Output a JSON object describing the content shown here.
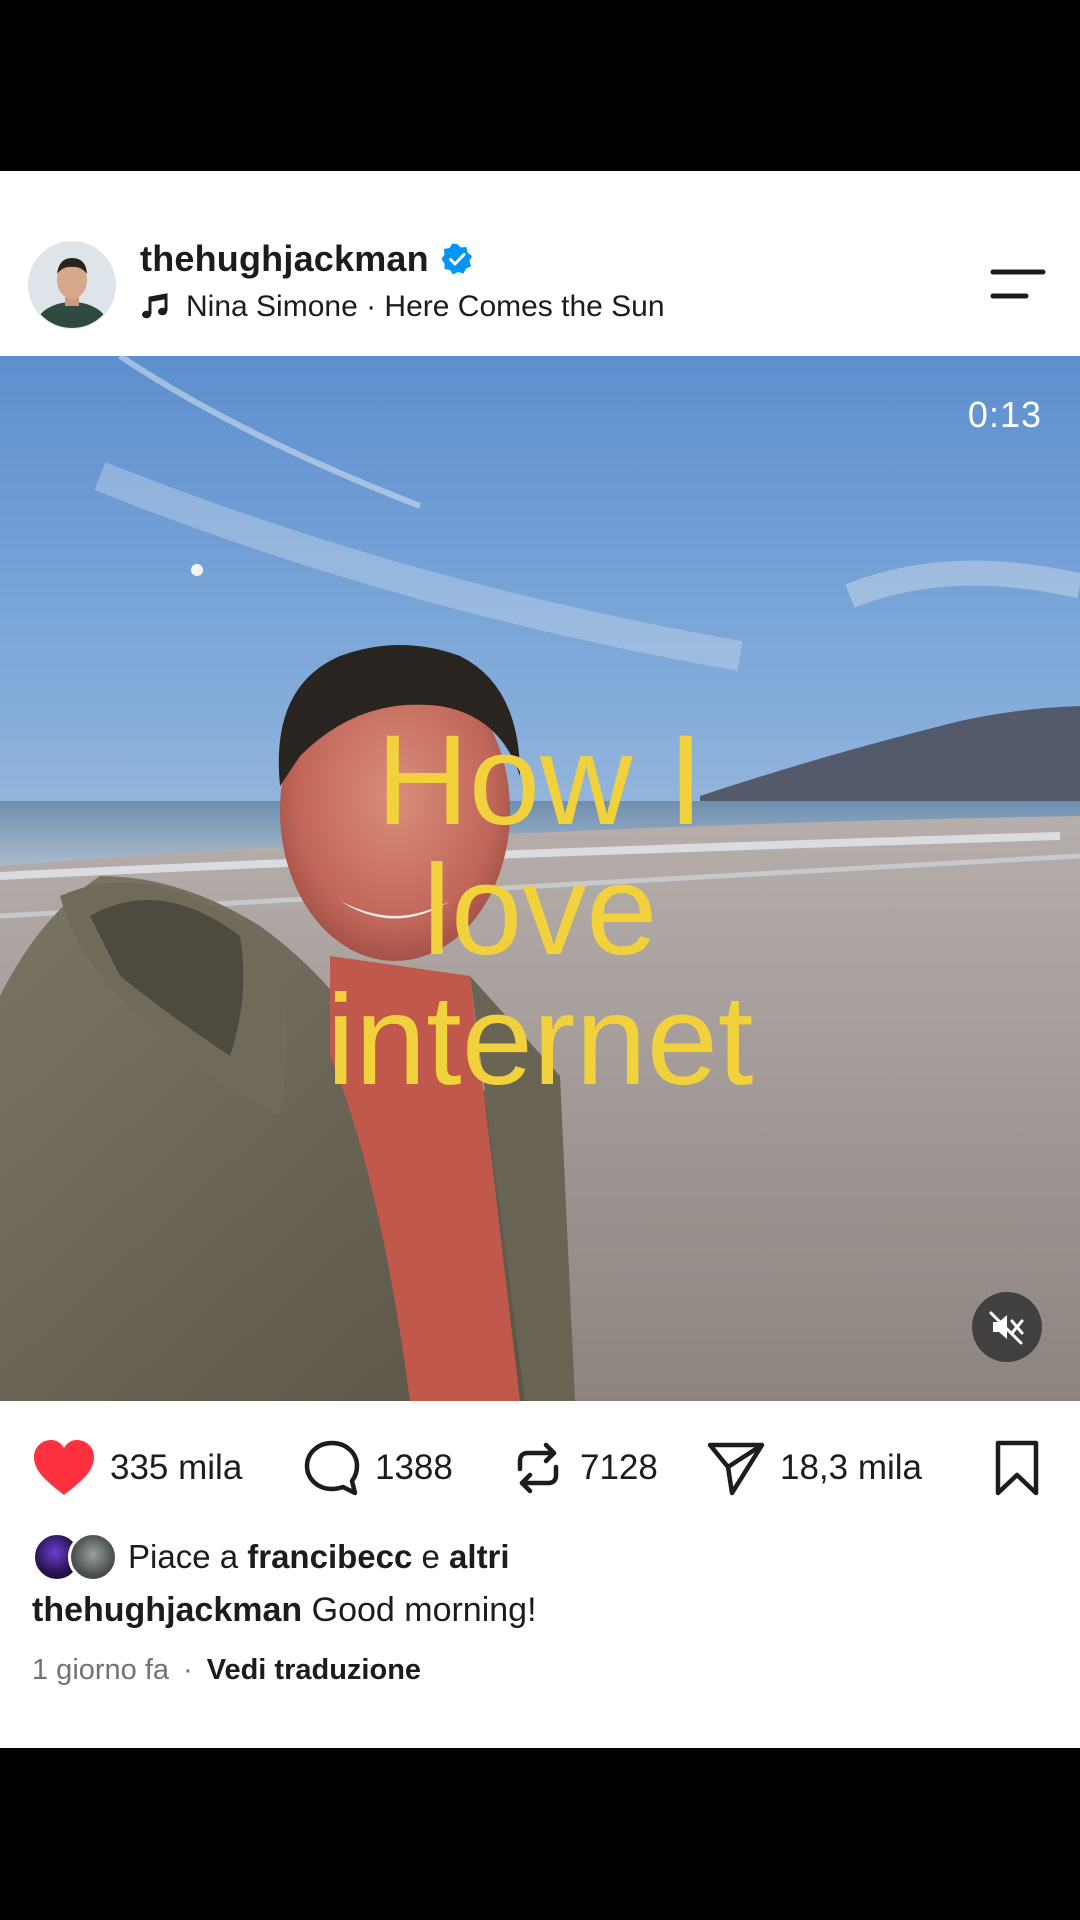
{
  "post": {
    "username": "thehughjackman",
    "verified": true,
    "music": "Nina Simone · Here Comes the Sun"
  },
  "media": {
    "timer": "0:13",
    "overlay_lines": [
      "How I",
      "love",
      "internet"
    ],
    "overlay_color": "#f2d23c",
    "muted": true
  },
  "actions": {
    "likes": "335 mila",
    "comments": "1388",
    "reposts": "7128",
    "shares": "18,3 mila"
  },
  "liked_by": {
    "prefix": "Piace a",
    "user": "francibecc",
    "connector": "e",
    "others": "altri"
  },
  "caption": {
    "username": "thehughjackman",
    "text": "Good morning!"
  },
  "meta": {
    "time": "1 giorno fa",
    "separator": "·",
    "translate": "Vedi traduzione"
  },
  "icons": {
    "like": "heart-icon",
    "comment": "comment-bubble-icon",
    "repost": "repost-arrows-icon",
    "share": "send-icon",
    "save": "bookmark-icon",
    "mute": "speaker-muted-icon",
    "music": "music-note-icon",
    "menu": "menu-lines-icon",
    "verified": "verified-badge-icon"
  },
  "colors": {
    "like_red": "#ff3040",
    "verified_blue": "#0095f6",
    "text": "#1c1c1c",
    "muted_text": "#737373"
  }
}
